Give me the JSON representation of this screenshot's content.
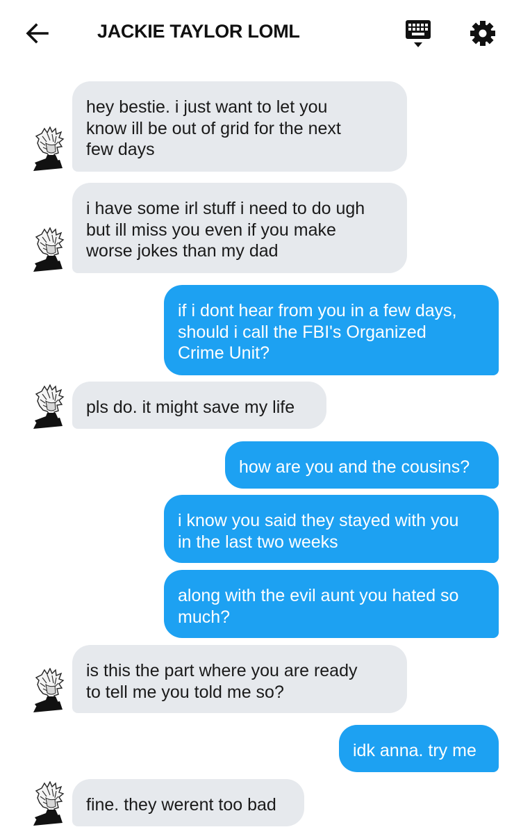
{
  "header": {
    "title": "JACKIE TAYLOR LOML",
    "back_icon": "arrow-left-icon",
    "keyboard_icon": "keyboard-icon",
    "settings_icon": "gear-icon"
  },
  "colors": {
    "incoming_bubble": "#e6e9ed",
    "outgoing_bubble": "#1da1f2",
    "outgoing_text": "#ffffff",
    "incoming_text": "#1a1a1a"
  },
  "messages": [
    {
      "sender": "them",
      "text": "hey bestie. i just want to let you\nknow ill be out of grid for the next\nfew days"
    },
    {
      "sender": "them",
      "text": "i have some irl stuff i need to do ugh\nbut ill miss you even if you make\nworse jokes than my dad"
    },
    {
      "sender": "me",
      "text": "if i dont hear from you in a few days,\nshould i call the FBI's Organized\nCrime Unit?"
    },
    {
      "sender": "them",
      "text": "pls do. it might save my life"
    },
    {
      "sender": "me",
      "text": "how are you and the cousins?"
    },
    {
      "sender": "me",
      "text": "i know you said they stayed with you\nin the last two weeks"
    },
    {
      "sender": "me",
      "text": "along with the evil aunt you hated so\nmuch?"
    },
    {
      "sender": "them",
      "text": "is this the part where you are ready\nto tell me you told me so?"
    },
    {
      "sender": "me",
      "text": "idk anna. try me"
    },
    {
      "sender": "them",
      "text": "fine. they werent too bad"
    }
  ]
}
